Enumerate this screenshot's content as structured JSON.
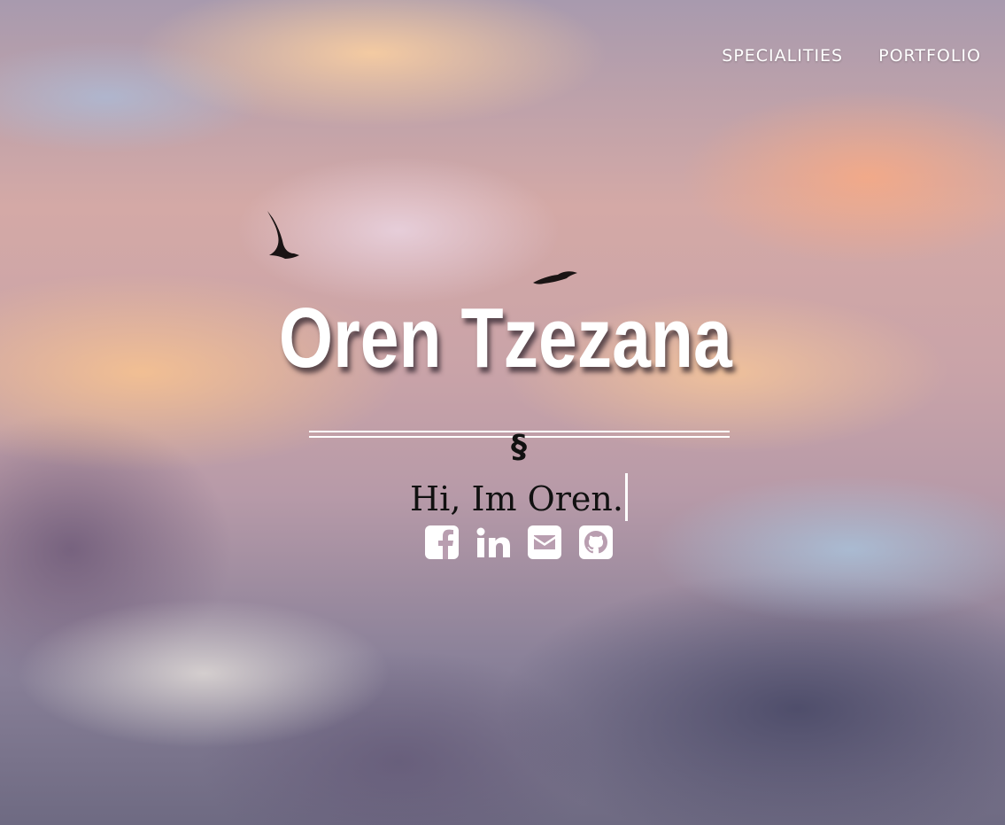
{
  "nav": {
    "items": [
      {
        "label": "SPECIALITIES"
      },
      {
        "label": "PORTFOLIO"
      }
    ]
  },
  "hero": {
    "title": "Oren Tzezana",
    "section_mark": "§",
    "tagline": "Hi, Im Oren."
  },
  "social": {
    "icons": [
      "facebook-icon",
      "linkedin-icon",
      "email-icon",
      "github-icon"
    ]
  },
  "colors": {
    "text_light": "#ffffff",
    "text_dark": "#111111"
  }
}
